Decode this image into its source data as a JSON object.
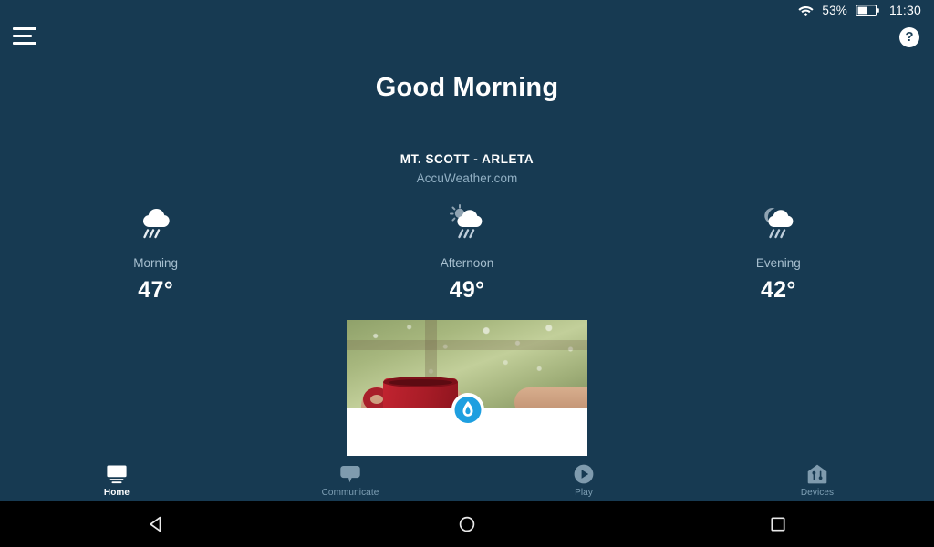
{
  "status_bar": {
    "wifi_icon": "wifi-icon",
    "battery_percent": "53%",
    "battery_icon": "battery-icon",
    "clock": "11:30"
  },
  "top_bar": {
    "menu_icon": "hamburger-menu-icon",
    "help_label": "?"
  },
  "greeting": "Good Morning",
  "weather": {
    "location": "MT. SCOTT - ARLETA",
    "provider": "AccuWeather.com",
    "forecast": [
      {
        "period": "Morning",
        "temp": "47°",
        "icon": "rain-cloud-icon"
      },
      {
        "period": "Afternoon",
        "temp": "49°",
        "icon": "sun-cloud-rain-icon"
      },
      {
        "period": "Evening",
        "temp": "42°",
        "icon": "moon-cloud-rain-icon"
      }
    ]
  },
  "promo_card": {
    "image_alt": "red-mug-rainy-window-photo",
    "badge_icon": "water-drop-pin-icon"
  },
  "bottom_nav": [
    {
      "label": "Home",
      "icon": "tv-home-icon",
      "active": true
    },
    {
      "label": "Communicate",
      "icon": "chat-bubble-icon",
      "active": false
    },
    {
      "label": "Play",
      "icon": "play-circle-icon",
      "active": false
    },
    {
      "label": "Devices",
      "icon": "house-devices-icon",
      "active": false
    }
  ],
  "system_nav": [
    {
      "name": "back",
      "icon": "back-triangle-icon"
    },
    {
      "name": "home",
      "icon": "home-circle-icon"
    },
    {
      "name": "recents",
      "icon": "recents-square-icon"
    }
  ],
  "colors": {
    "background": "#173a52",
    "accent_badge": "#1e9fe0",
    "muted_text": "#a7bfcf",
    "provider_text": "#92b0c4"
  }
}
